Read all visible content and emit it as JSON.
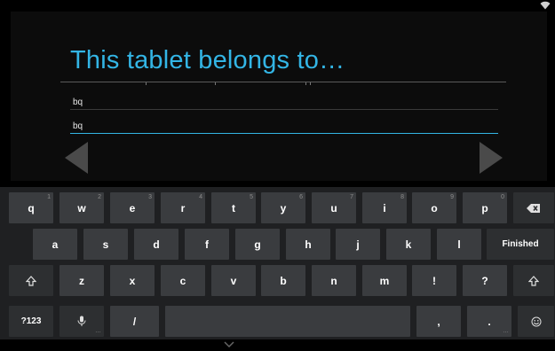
{
  "setup": {
    "title": "This tablet belongs to…",
    "fields": [
      {
        "value": "bq"
      },
      {
        "value": "bq"
      }
    ]
  },
  "keyboard": {
    "row1": [
      {
        "label": "q",
        "hint": "1"
      },
      {
        "label": "w",
        "hint": "2"
      },
      {
        "label": "e",
        "hint": "3"
      },
      {
        "label": "r",
        "hint": "4"
      },
      {
        "label": "t",
        "hint": "5"
      },
      {
        "label": "y",
        "hint": "6"
      },
      {
        "label": "u",
        "hint": "7"
      },
      {
        "label": "i",
        "hint": "8"
      },
      {
        "label": "o",
        "hint": "9"
      },
      {
        "label": "p",
        "hint": "0"
      }
    ],
    "row2": [
      "a",
      "s",
      "d",
      "f",
      "g",
      "h",
      "j",
      "k",
      "l"
    ],
    "row3": [
      "z",
      "x",
      "c",
      "v",
      "b",
      "n",
      "m",
      "!",
      "?"
    ],
    "finished_label": "Finished",
    "symbols_label": "?123",
    "slash_label": "/",
    "comma_label": ",",
    "period_label": ".",
    "more_hint": "…"
  },
  "colors": {
    "accent": "#33b5e5",
    "key": "#3a3c3f",
    "key_dark": "#2d2f31",
    "keyboard_bg": "#1f2022"
  },
  "icons": {
    "backspace": "backspace-icon",
    "shift": "shift-icon",
    "mic": "microphone-icon",
    "emoji": "smiley-icon",
    "wifi": "wifi-icon",
    "back": "back-arrow-icon",
    "next": "next-arrow-icon",
    "hide": "hide-keyboard-chevron-icon"
  }
}
